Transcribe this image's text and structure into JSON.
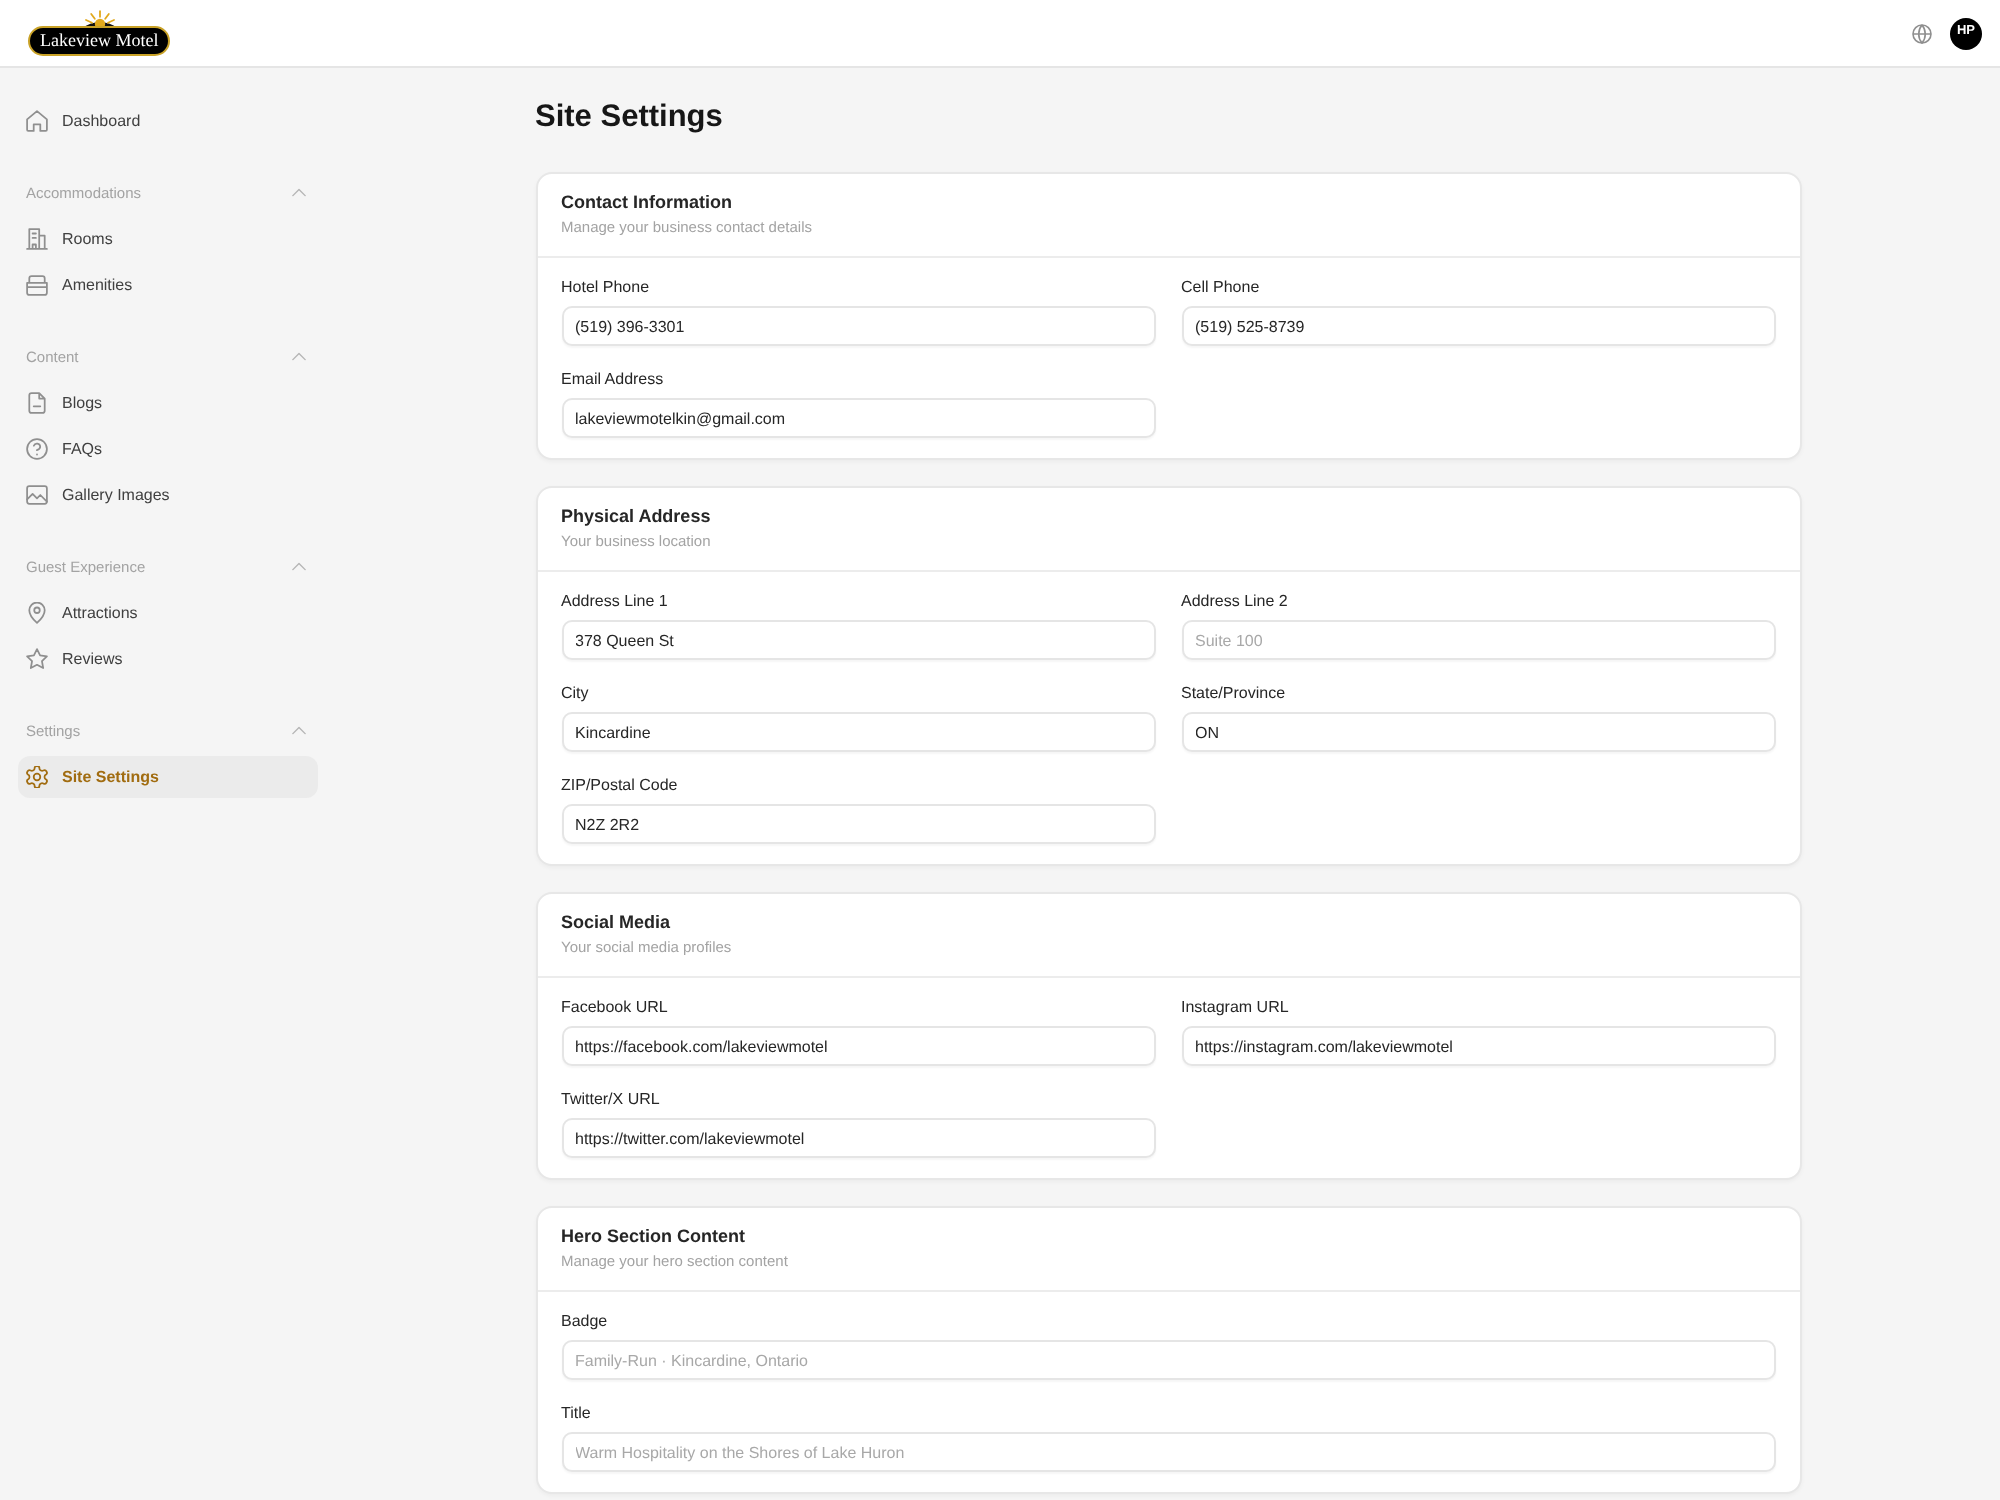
{
  "header": {
    "logo": "Lakeview Motel",
    "avatar": "HP"
  },
  "sidebar": {
    "items": [
      {
        "label": "Dashboard",
        "selected": false
      }
    ],
    "groups": [
      {
        "heading": "Accommodations",
        "expanded": true,
        "items": [
          {
            "label": "Rooms",
            "selected": false
          },
          {
            "label": "Amenities",
            "selected": false
          }
        ]
      },
      {
        "heading": "Content",
        "expanded": true,
        "items": [
          {
            "label": "Blogs",
            "selected": false
          },
          {
            "label": "FAQs",
            "selected": false
          },
          {
            "label": "Gallery Images",
            "selected": false
          }
        ]
      },
      {
        "heading": "Guest Experience",
        "expanded": true,
        "items": [
          {
            "label": "Attractions",
            "selected": false
          },
          {
            "label": "Reviews",
            "selected": false
          }
        ]
      },
      {
        "heading": "Settings",
        "expanded": true,
        "items": [
          {
            "label": "Site Settings",
            "selected": true
          }
        ]
      }
    ]
  },
  "page_title": "Site Settings",
  "sections": [
    {
      "kind": "grid",
      "title": "Contact Information",
      "subtitle": "Manage your business contact details",
      "fields": [
        {
          "label": "Hotel Phone",
          "value": "(519) 396-3301"
        },
        {
          "label": "Cell Phone",
          "value": "(519) 525-8739"
        },
        {
          "label": "Email Address",
          "value": "lakeviewmotelkin@gmail.com"
        }
      ]
    },
    {
      "kind": "grid",
      "title": "Physical Address",
      "subtitle": "Your business location",
      "fields": [
        {
          "label": "Address Line 1",
          "value": "378 Queen St"
        },
        {
          "label": "Address Line 2",
          "placeholder": "Suite 100"
        },
        {
          "label": "City",
          "value": "Kincardine"
        },
        {
          "label": "State/Province",
          "value": "ON"
        },
        {
          "label": "ZIP/Postal Code",
          "value": "N2Z 2R2"
        }
      ]
    },
    {
      "kind": "grid",
      "title": "Social Media",
      "subtitle": "Your social media profiles",
      "fields": [
        {
          "label": "Facebook URL",
          "value": "https://facebook.com/lakeviewmotel"
        },
        {
          "label": "Instagram URL",
          "value": "https://instagram.com/lakeviewmotel"
        },
        {
          "label": "Twitter/X URL",
          "value": "https://twitter.com/lakeviewmotel"
        }
      ]
    },
    {
      "kind": "stack",
      "title": "Hero Section Content",
      "subtitle": "Manage your hero section content",
      "fields": [
        {
          "label": "Badge",
          "placeholder": "Family-Run · Kincardine, Ontario"
        },
        {
          "label": "Title",
          "placeholder": "Warm Hospitality on the Shores of Lake Huron"
        }
      ]
    }
  ]
}
